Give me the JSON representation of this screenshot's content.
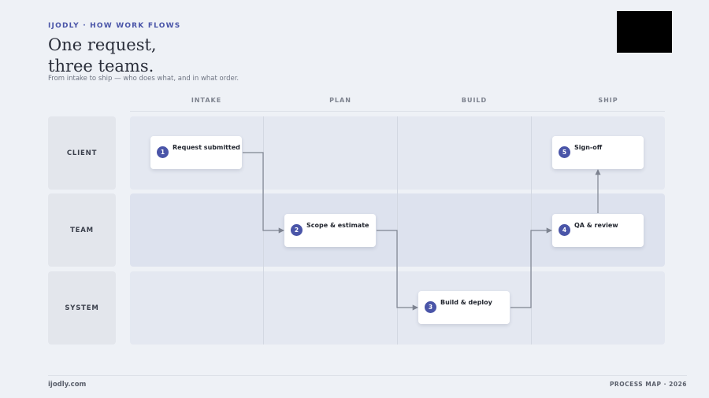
{
  "header": {
    "eyebrow": "IJODLY · HOW WORK FLOWS",
    "title_line1": "One request,",
    "title_line2": "three teams.",
    "subtitle": "From intake to ship — who does what, and in what order."
  },
  "columns": [
    "INTAKE",
    "PLAN",
    "BUILD",
    "SHIP"
  ],
  "lanes": [
    "CLIENT",
    "TEAM",
    "SYSTEM"
  ],
  "steps": [
    {
      "num": "1",
      "label": "Request submitted",
      "lane": "CLIENT",
      "column": "INTAKE"
    },
    {
      "num": "2",
      "label": "Scope & estimate",
      "lane": "TEAM",
      "column": "PLAN"
    },
    {
      "num": "3",
      "label": "Build & deploy",
      "lane": "SYSTEM",
      "column": "BUILD"
    },
    {
      "num": "4",
      "label": "QA & review",
      "lane": "TEAM",
      "column": "SHIP"
    },
    {
      "num": "5",
      "label": "Sign-off",
      "lane": "CLIENT",
      "column": "SHIP"
    }
  ],
  "flow": [
    [
      "1",
      "2"
    ],
    [
      "2",
      "3"
    ],
    [
      "3",
      "4"
    ],
    [
      "4",
      "5"
    ]
  ],
  "footer": {
    "left": "ijodly.com",
    "right": "PROCESS MAP · 2026"
  },
  "colors": {
    "accent": "#4a55a8",
    "background": "#eef1f6",
    "connector": "#7e8491"
  }
}
